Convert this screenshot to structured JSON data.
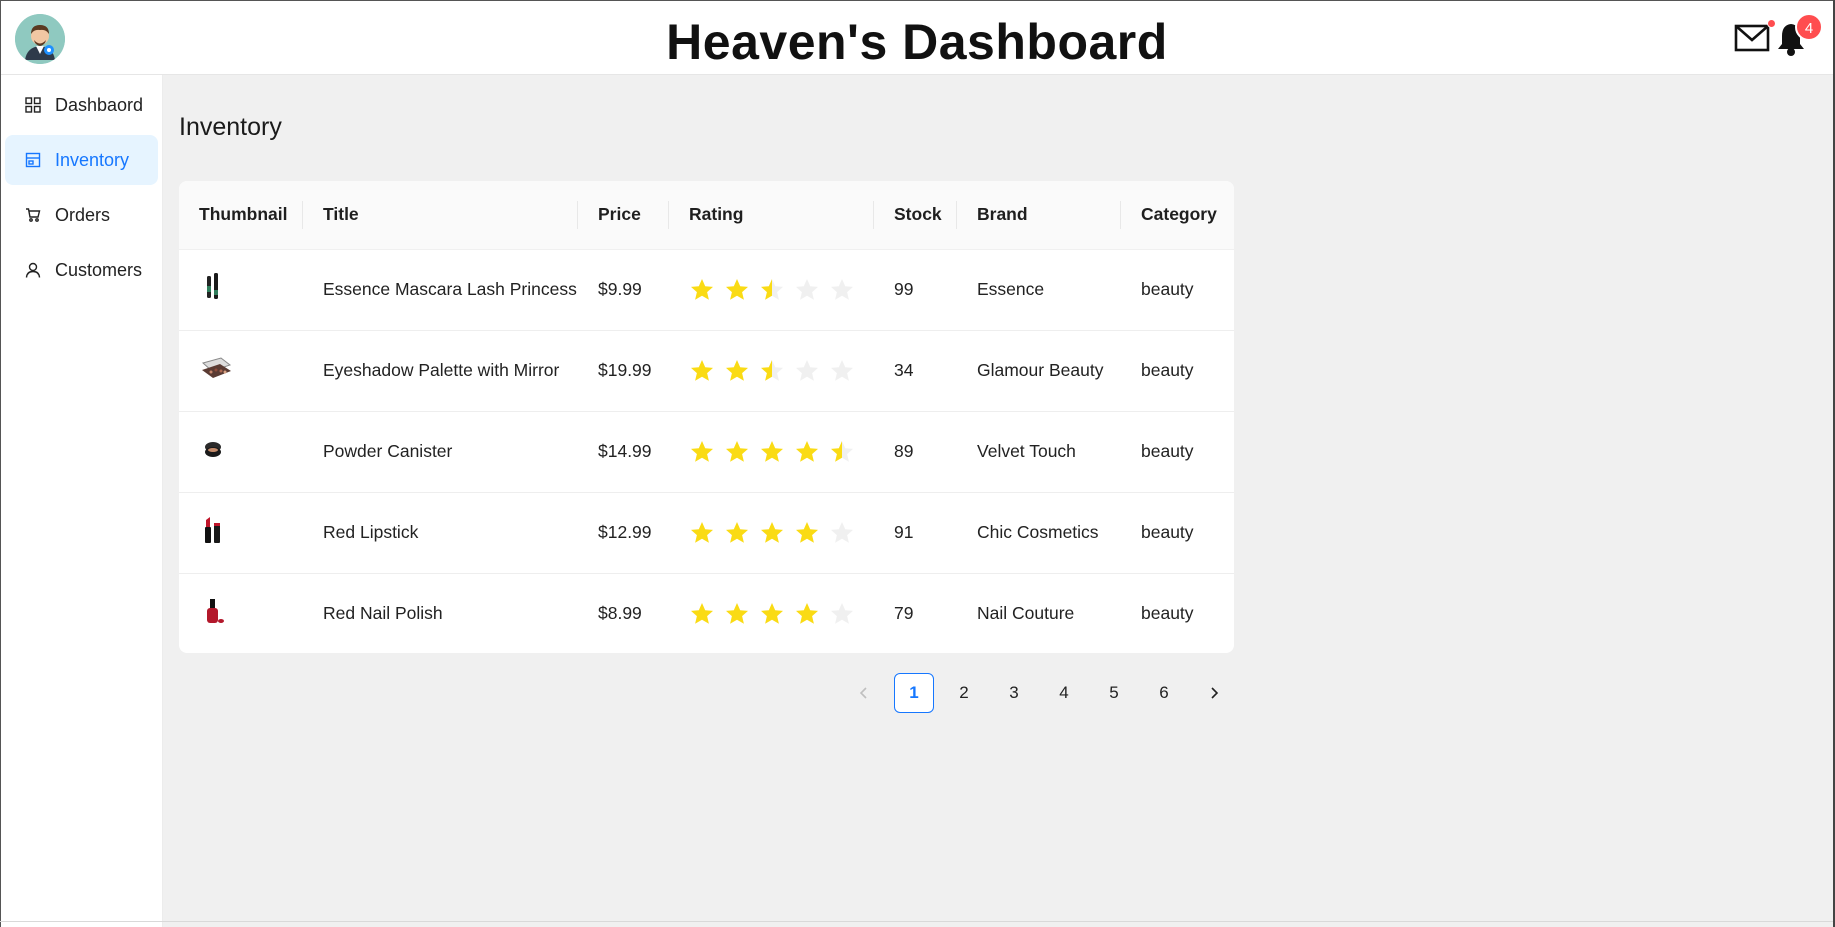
{
  "header": {
    "title": "Heaven's Dashboard",
    "notification_count": "4",
    "avatar_icon": "user-avatar-icon",
    "mail_icon": "mail-icon",
    "bell_icon": "bell-icon"
  },
  "sidebar": {
    "items": [
      {
        "label": "Dashbaord",
        "icon": "grid-icon",
        "active": false
      },
      {
        "label": "Inventory",
        "icon": "shop-icon",
        "active": true
      },
      {
        "label": "Orders",
        "icon": "cart-icon",
        "active": false
      },
      {
        "label": "Customers",
        "icon": "user-icon",
        "active": false
      }
    ]
  },
  "main": {
    "page_title": "Inventory",
    "table": {
      "columns": [
        "Thumbnail",
        "Title",
        "Price",
        "Rating",
        "Stock",
        "Brand",
        "Category"
      ],
      "rows": [
        {
          "thumb": "mascara-thumbnail",
          "title": "Essence Mascara Lash Princess",
          "price": "$9.99",
          "rating": 2.5,
          "stock": "99",
          "brand": "Essence",
          "category": "beauty"
        },
        {
          "thumb": "eyeshadow-thumbnail",
          "title": "Eyeshadow Palette with Mirror",
          "price": "$19.99",
          "rating": 2.5,
          "stock": "34",
          "brand": "Glamour Beauty",
          "category": "beauty"
        },
        {
          "thumb": "powder-thumbnail",
          "title": "Powder Canister",
          "price": "$14.99",
          "rating": 4.5,
          "stock": "89",
          "brand": "Velvet Touch",
          "category": "beauty"
        },
        {
          "thumb": "lipstick-thumbnail",
          "title": "Red Lipstick",
          "price": "$12.99",
          "rating": 4,
          "stock": "91",
          "brand": "Chic Cosmetics",
          "category": "beauty"
        },
        {
          "thumb": "nail-polish-thumbnail",
          "title": "Red Nail Polish",
          "price": "$8.99",
          "rating": 4,
          "stock": "79",
          "brand": "Nail Couture",
          "category": "beauty"
        }
      ]
    },
    "pagination": {
      "pages": [
        "1",
        "2",
        "3",
        "4",
        "5",
        "6"
      ],
      "current": "1",
      "prev_icon": "chevron-left-icon",
      "next_icon": "chevron-right-icon"
    }
  },
  "colors": {
    "accent": "#1677ff",
    "star_filled": "#fadb14",
    "star_empty": "#f0f0f0",
    "badge": "#ff4d4f"
  }
}
